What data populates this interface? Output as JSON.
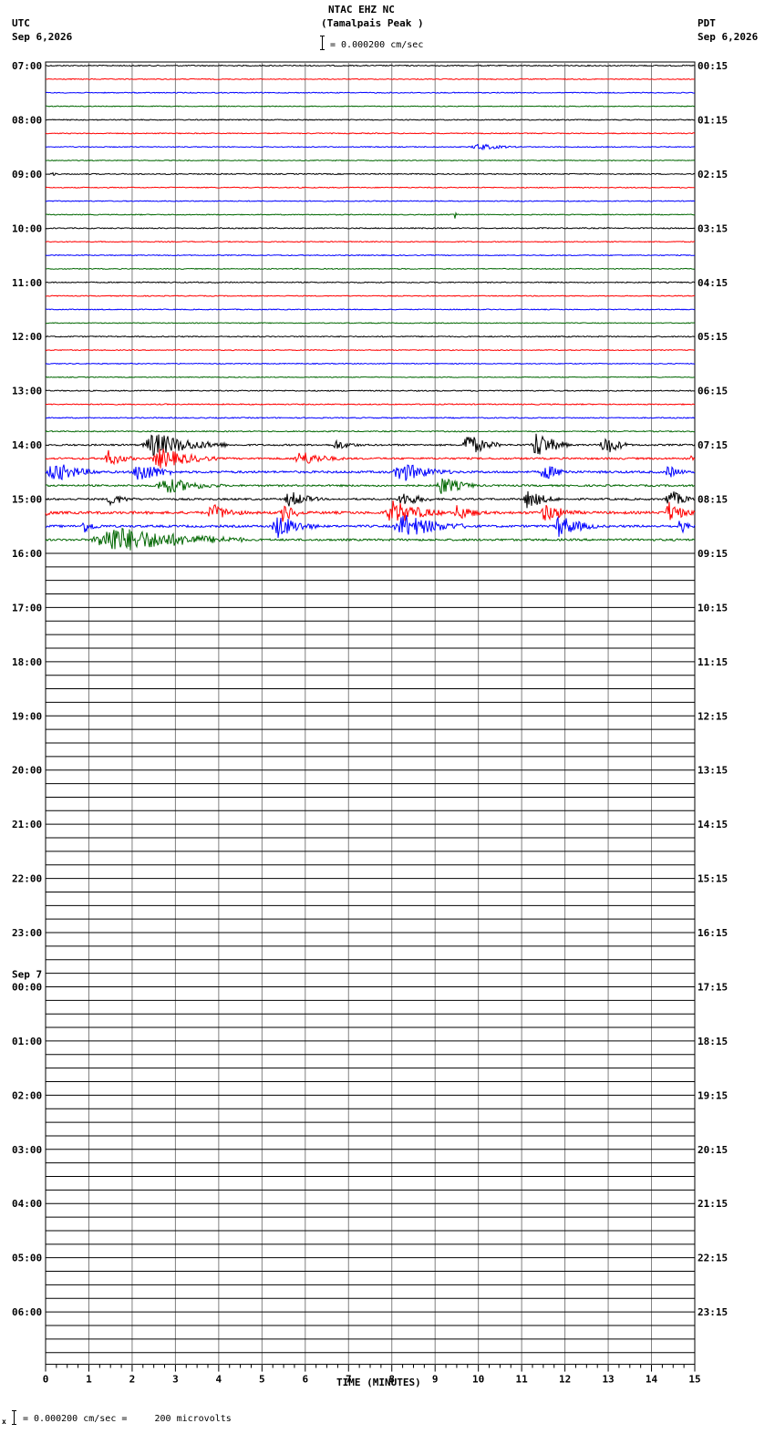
{
  "header": {
    "station": "NTAC EHZ NC",
    "site": "(Tamalpais Peak )",
    "scale_text": "= 0.000200 cm/sec",
    "left_zone": "UTC",
    "left_date": "Sep 6,2026",
    "right_zone": "PDT",
    "right_date": "Sep 6,2026"
  },
  "footer": {
    "scale_text": "= 0.000200 cm/sec =     200 microvolts"
  },
  "chart_data": {
    "type": "line",
    "title": "NTAC EHZ NC (Tamalpais Peak )",
    "xlabel": "TIME (MINUTES)",
    "xlim": [
      0,
      15
    ],
    "x_ticks": [
      "0",
      "1",
      "2",
      "3",
      "4",
      "5",
      "6",
      "7",
      "8",
      "9",
      "10",
      "11",
      "12",
      "13",
      "14",
      "15"
    ],
    "traces_per_hour": 4,
    "trace_colors": [
      "#000000",
      "#ff0000",
      "#0000ff",
      "#006600"
    ],
    "day_change_label": "Sep 7",
    "utc_hour_labels": [
      "07:00",
      "08:00",
      "09:00",
      "10:00",
      "11:00",
      "12:00",
      "13:00",
      "14:00",
      "15:00",
      "16:00",
      "17:00",
      "18:00",
      "19:00",
      "20:00",
      "21:00",
      "22:00",
      "23:00",
      "00:00",
      "01:00",
      "02:00",
      "03:00",
      "04:00",
      "05:00",
      "06:00"
    ],
    "pdt_hour_labels": [
      "00:15",
      "01:15",
      "02:15",
      "03:15",
      "04:15",
      "05:15",
      "06:15",
      "07:15",
      "08:15",
      "09:15",
      "10:15",
      "11:15",
      "12:15",
      "13:15",
      "14:15",
      "15:15",
      "16:15",
      "17:15",
      "18:15",
      "19:15",
      "20:15",
      "21:15",
      "22:15",
      "23:15"
    ],
    "active_traces": 36,
    "noise_level": [
      0.6,
      0.5,
      0.5,
      0.45,
      0.55,
      0.5,
      0.5,
      0.45,
      0.6,
      0.5,
      0.5,
      0.5,
      0.6,
      0.5,
      0.5,
      0.5,
      0.6,
      0.5,
      0.5,
      0.45,
      0.6,
      0.5,
      0.5,
      0.45,
      0.6,
      0.6,
      0.6,
      0.6,
      0.9,
      1.0,
      1.2,
      1.0,
      1.0,
      1.4,
      1.2,
      1.1
    ],
    "events": [
      {
        "trace": 6,
        "minute": 9.8,
        "duration": 1.2,
        "amplitude": 4
      },
      {
        "trace": 8,
        "minute": 0.1,
        "duration": 0.2,
        "amplitude": 3
      },
      {
        "trace": 11,
        "minute": 9.45,
        "duration": 0.05,
        "amplitude": 10
      },
      {
        "trace": 28,
        "minute": 2.2,
        "duration": 2.0,
        "amplitude": 14
      },
      {
        "trace": 28,
        "minute": 6.6,
        "duration": 0.8,
        "amplitude": 6
      },
      {
        "trace": 28,
        "minute": 9.6,
        "duration": 0.9,
        "amplitude": 14
      },
      {
        "trace": 28,
        "minute": 11.2,
        "duration": 0.9,
        "amplitude": 16
      },
      {
        "trace": 28,
        "minute": 12.8,
        "duration": 0.7,
        "amplitude": 13
      },
      {
        "trace": 29,
        "minute": 1.3,
        "duration": 0.8,
        "amplitude": 10
      },
      {
        "trace": 29,
        "minute": 2.4,
        "duration": 1.6,
        "amplitude": 12
      },
      {
        "trace": 29,
        "minute": 5.7,
        "duration": 1.2,
        "amplitude": 9
      },
      {
        "trace": 29,
        "minute": 14.9,
        "duration": 0.1,
        "amplitude": 5
      },
      {
        "trace": 30,
        "minute": 0.0,
        "duration": 1.3,
        "amplitude": 12
      },
      {
        "trace": 30,
        "minute": 2.0,
        "duration": 1.0,
        "amplitude": 14
      },
      {
        "trace": 30,
        "minute": 8.0,
        "duration": 1.4,
        "amplitude": 12
      },
      {
        "trace": 30,
        "minute": 11.4,
        "duration": 0.8,
        "amplitude": 10
      },
      {
        "trace": 30,
        "minute": 14.3,
        "duration": 0.6,
        "amplitude": 8
      },
      {
        "trace": 31,
        "minute": 2.5,
        "duration": 1.6,
        "amplitude": 10
      },
      {
        "trace": 31,
        "minute": 9.0,
        "duration": 1.0,
        "amplitude": 11
      },
      {
        "trace": 32,
        "minute": 1.4,
        "duration": 0.7,
        "amplitude": 8
      },
      {
        "trace": 32,
        "minute": 5.5,
        "duration": 0.9,
        "amplitude": 10
      },
      {
        "trace": 32,
        "minute": 8.1,
        "duration": 0.9,
        "amplitude": 9
      },
      {
        "trace": 32,
        "minute": 11.0,
        "duration": 0.9,
        "amplitude": 11
      },
      {
        "trace": 32,
        "minute": 14.3,
        "duration": 0.7,
        "amplitude": 12
      },
      {
        "trace": 33,
        "minute": 0.0,
        "duration": 0.2,
        "amplitude": 6
      },
      {
        "trace": 33,
        "minute": 3.7,
        "duration": 1.0,
        "amplitude": 10
      },
      {
        "trace": 33,
        "minute": 5.4,
        "duration": 0.6,
        "amplitude": 12
      },
      {
        "trace": 33,
        "minute": 7.8,
        "duration": 1.5,
        "amplitude": 14
      },
      {
        "trace": 33,
        "minute": 9.4,
        "duration": 0.8,
        "amplitude": 10
      },
      {
        "trace": 33,
        "minute": 11.4,
        "duration": 1.0,
        "amplitude": 11
      },
      {
        "trace": 33,
        "minute": 14.3,
        "duration": 0.7,
        "amplitude": 13
      },
      {
        "trace": 34,
        "minute": 0.8,
        "duration": 0.6,
        "amplitude": 8
      },
      {
        "trace": 34,
        "minute": 5.2,
        "duration": 1.1,
        "amplitude": 14
      },
      {
        "trace": 34,
        "minute": 8.0,
        "duration": 1.8,
        "amplitude": 14
      },
      {
        "trace": 34,
        "minute": 11.7,
        "duration": 1.1,
        "amplitude": 13
      },
      {
        "trace": 34,
        "minute": 14.6,
        "duration": 0.4,
        "amplitude": 10
      },
      {
        "trace": 35,
        "minute": 1.0,
        "duration": 3.6,
        "amplitude": 16
      }
    ]
  }
}
